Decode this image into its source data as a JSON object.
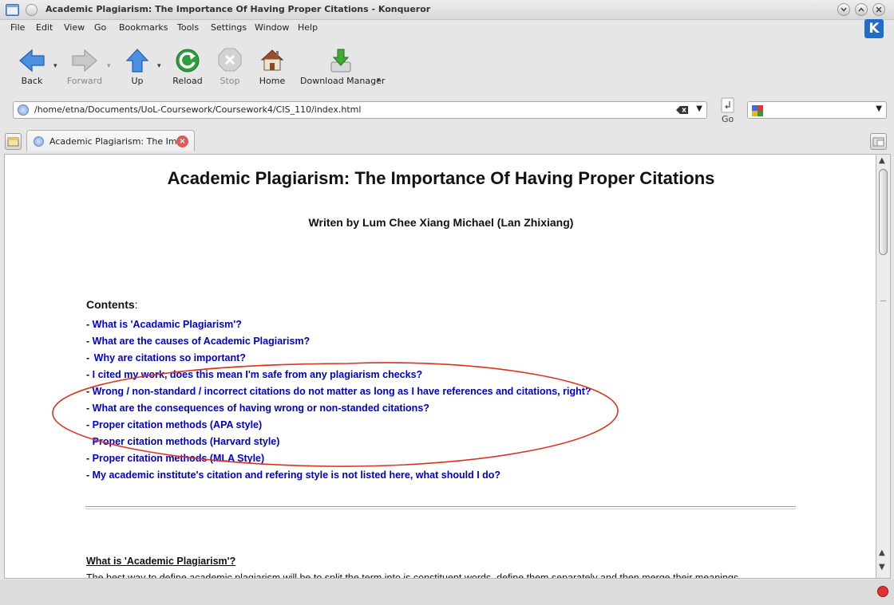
{
  "window": {
    "title": "Academic Plagiarism: The Importance Of Having Proper Citations - Konqueror"
  },
  "menu": [
    "File",
    "Edit",
    "View",
    "Go",
    "Bookmarks",
    "Tools",
    "Settings",
    "Window",
    "Help"
  ],
  "toolbar": {
    "back": "Back",
    "forward": "Forward",
    "up": "Up",
    "reload": "Reload",
    "stop": "Stop",
    "home": "Home",
    "download": "Download Manager"
  },
  "location": {
    "url": "/home/etna/Documents/UoL-Coursework/Coursework4/CIS_110/index.html",
    "go_label": "Go",
    "search_value": ""
  },
  "tab": {
    "label": "Academic Plagiarism: The Im..."
  },
  "page": {
    "title": "Academic Plagiarism: The Importance Of Having Proper Citations",
    "author": "Writen by Lum Chee Xiang Michael (Lan Zhixiang)",
    "contents_label": "Contents",
    "contents_colon": ":",
    "toc": [
      "What is 'Acadamic Plagiarism'?",
      "What are the causes of Academic Plagiarism?",
      "Why are citations so important?",
      "I cited my work, does this mean I'm safe from any plagiarism checks?",
      "Wrong / non-standard / incorrect citations do not matter as long as I have references and citations, right?",
      "What are the consequences of having wrong or non-standed citations?",
      "Proper citation methods (APA style)",
      "Proper citation methods (Harvard style)",
      "Proper citation methods (MLA Style)",
      "My academic institute's citation and refering style is not listed here, what should I do?"
    ],
    "section_heading": "What is 'Academic Plagiarism'?",
    "section_text": "The best way to define academic plagiarism will be to split the term into is constituent words, define them separately and then merge their meanings"
  },
  "colors": {
    "link": "#0000cc",
    "annotation": "#d9331f"
  }
}
